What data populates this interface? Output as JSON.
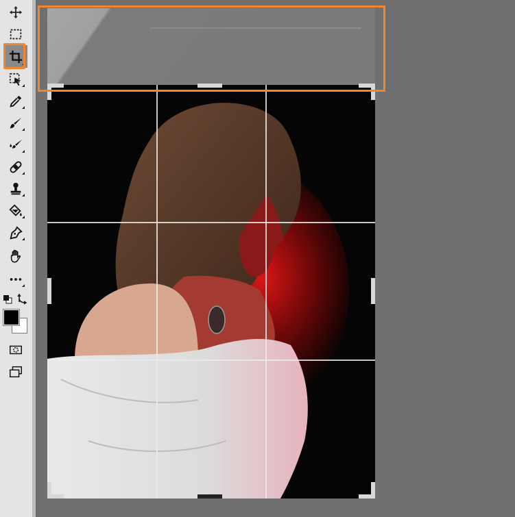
{
  "toolbar": {
    "tools": [
      {
        "name": "move-tool",
        "icon": "move-icon"
      },
      {
        "name": "marquee-tool",
        "icon": "marquee-icon"
      },
      {
        "name": "crop-tool",
        "icon": "crop-icon",
        "active": true
      },
      {
        "name": "object-select-tool",
        "icon": "object-select-icon"
      },
      {
        "name": "eyedropper-tool",
        "icon": "eyedropper-icon"
      },
      {
        "name": "brush-tool",
        "icon": "brush-icon"
      },
      {
        "name": "spot-healing-tool",
        "icon": "spot-healing-icon"
      },
      {
        "name": "healing-tool",
        "icon": "bandage-icon"
      },
      {
        "name": "stamp-tool",
        "icon": "stamp-icon"
      },
      {
        "name": "paint-bucket-tool",
        "icon": "paint-bucket-icon"
      },
      {
        "name": "pen-tool",
        "icon": "pen-icon"
      },
      {
        "name": "hand-tool",
        "icon": "hand-icon"
      },
      {
        "name": "more-tools",
        "icon": "more-icon"
      },
      {
        "name": "swap-colors",
        "icon": "swap-colors-icon"
      },
      {
        "name": "quick-mask",
        "icon": "quick-mask-icon"
      },
      {
        "name": "screen-mode",
        "icon": "screen-mode-icon"
      }
    ],
    "foreground_color": "#000000",
    "background_color": "#ffffff"
  },
  "colors": {
    "highlight": "#f0862d",
    "workspace": "#6f6f6f",
    "grid": "#ebebeb"
  },
  "crop": {
    "grid": "rule-of-thirds"
  }
}
